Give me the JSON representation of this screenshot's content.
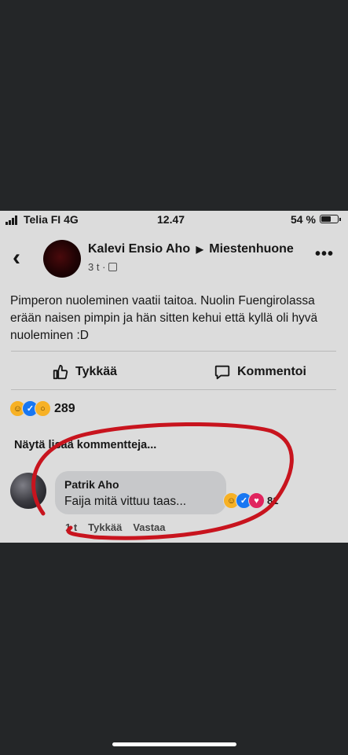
{
  "status_bar": {
    "carrier": "Telia FI 4G",
    "time": "12.47",
    "battery": "54 %",
    "battery_level": 0.54
  },
  "post": {
    "author": "Kalevi Ensio Aho",
    "group": "Miestenhuone",
    "meta": "3 t ·",
    "text": "Pimperon nuoleminen vaatii taitoa. Nuolin Fuengirolassa erään naisen pimpin ja hän sitten kehui että kyllä oli hyvä nuoleminen :D",
    "like_label": "Tykkää",
    "comment_label": "Kommentoi",
    "reaction_count": "289",
    "reactions": [
      "haha",
      "like",
      "wow"
    ]
  },
  "comments": {
    "more_label": "Näytä lisää kommentteja...",
    "items": [
      {
        "name": "Patrik Aho",
        "text": "Faija mitä vittuu taas...",
        "reaction_count": "81",
        "reactions": [
          "haha",
          "like",
          "love"
        ],
        "time": "1 t",
        "like_label": "Tykkää",
        "reply_label": "Vastaa"
      }
    ]
  },
  "annotation_color": "#c8141e",
  "icons": {
    "back": "chevron-left-icon",
    "more": "more-horizontal-icon",
    "audience": "audience-icon",
    "like": "thumbs-up-icon",
    "comment": "speech-bubble-icon"
  }
}
